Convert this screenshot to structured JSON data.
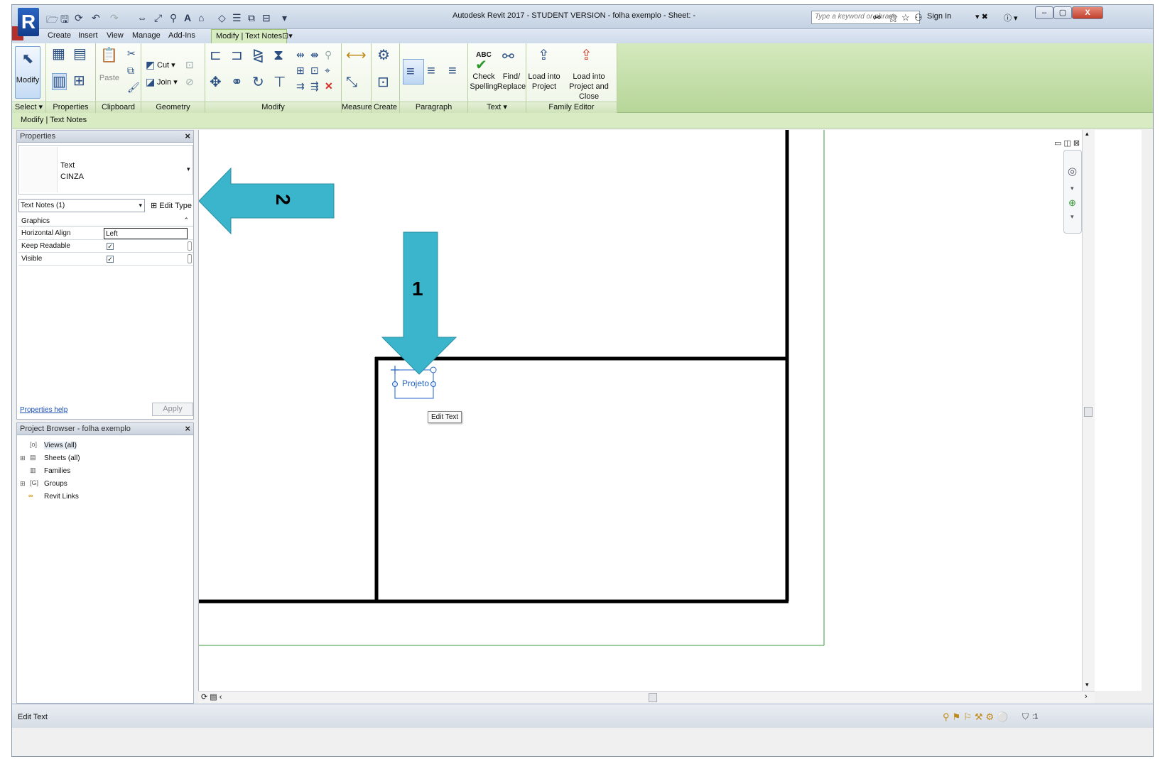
{
  "app": {
    "logo": "R",
    "title": "Autodesk Revit 2017 - STUDENT VERSION -     folha exemplo - Sheet: -",
    "search_placeholder": "Type a keyword or phrase",
    "sign_in": "Sign In",
    "window_buttons": [
      "–",
      "▢",
      "X"
    ]
  },
  "tabs": [
    "Create",
    "Insert",
    "View",
    "Manage",
    "Add-Ins"
  ],
  "active_tab": "Modify | Text Notes",
  "ribbon": {
    "modify_label": "Modify",
    "select_label": "Select ▾",
    "panels": {
      "properties": "Properties",
      "clipboard": "Clipboard",
      "geometry": "Geometry",
      "modify": "Modify",
      "measure": "Measure",
      "create": "Create",
      "paragraph": "Paragraph",
      "text": "Text ▾",
      "family_editor": "Family Editor"
    },
    "paste": "Paste",
    "cut": "Cut ▾",
    "join": "Join ▾",
    "abc": "ABC",
    "check_spelling": [
      "Check",
      "Spelling"
    ],
    "find_replace": [
      "Find/",
      "Replace"
    ],
    "load_into_project": [
      "Load into",
      "Project"
    ],
    "load_into_project_close": [
      "Load into",
      "Project and Close"
    ]
  },
  "context_bar": "Modify | Text Notes",
  "properties": {
    "header": "Properties",
    "type_name": "Text",
    "type_sub": "CINZA",
    "instance_selector": "Text Notes (1)",
    "edit_type": "Edit Type",
    "group": "Graphics",
    "rows": [
      {
        "name": "Horizontal Align",
        "value": "Left"
      },
      {
        "name": "Keep Readable",
        "value": "✓"
      },
      {
        "name": "Visible",
        "value": "✓"
      }
    ],
    "help_link": "Properties help",
    "apply": "Apply"
  },
  "browser": {
    "header": "Project Browser - folha exemplo",
    "items": [
      "Views (all)",
      "Sheets (all)",
      "Families",
      "Groups",
      "Revit Links"
    ]
  },
  "canvas": {
    "text_note": "Projeto",
    "tooltip": "Edit Text",
    "arrow1_label": "1",
    "arrow2_label": "2"
  },
  "status": {
    "text": "Edit Text",
    "filter_count": ":1"
  },
  "colors": {
    "arrow": "#3ab5cc",
    "ribbon_green": "#c6e2a8",
    "border_green": "#3a9a3a"
  }
}
